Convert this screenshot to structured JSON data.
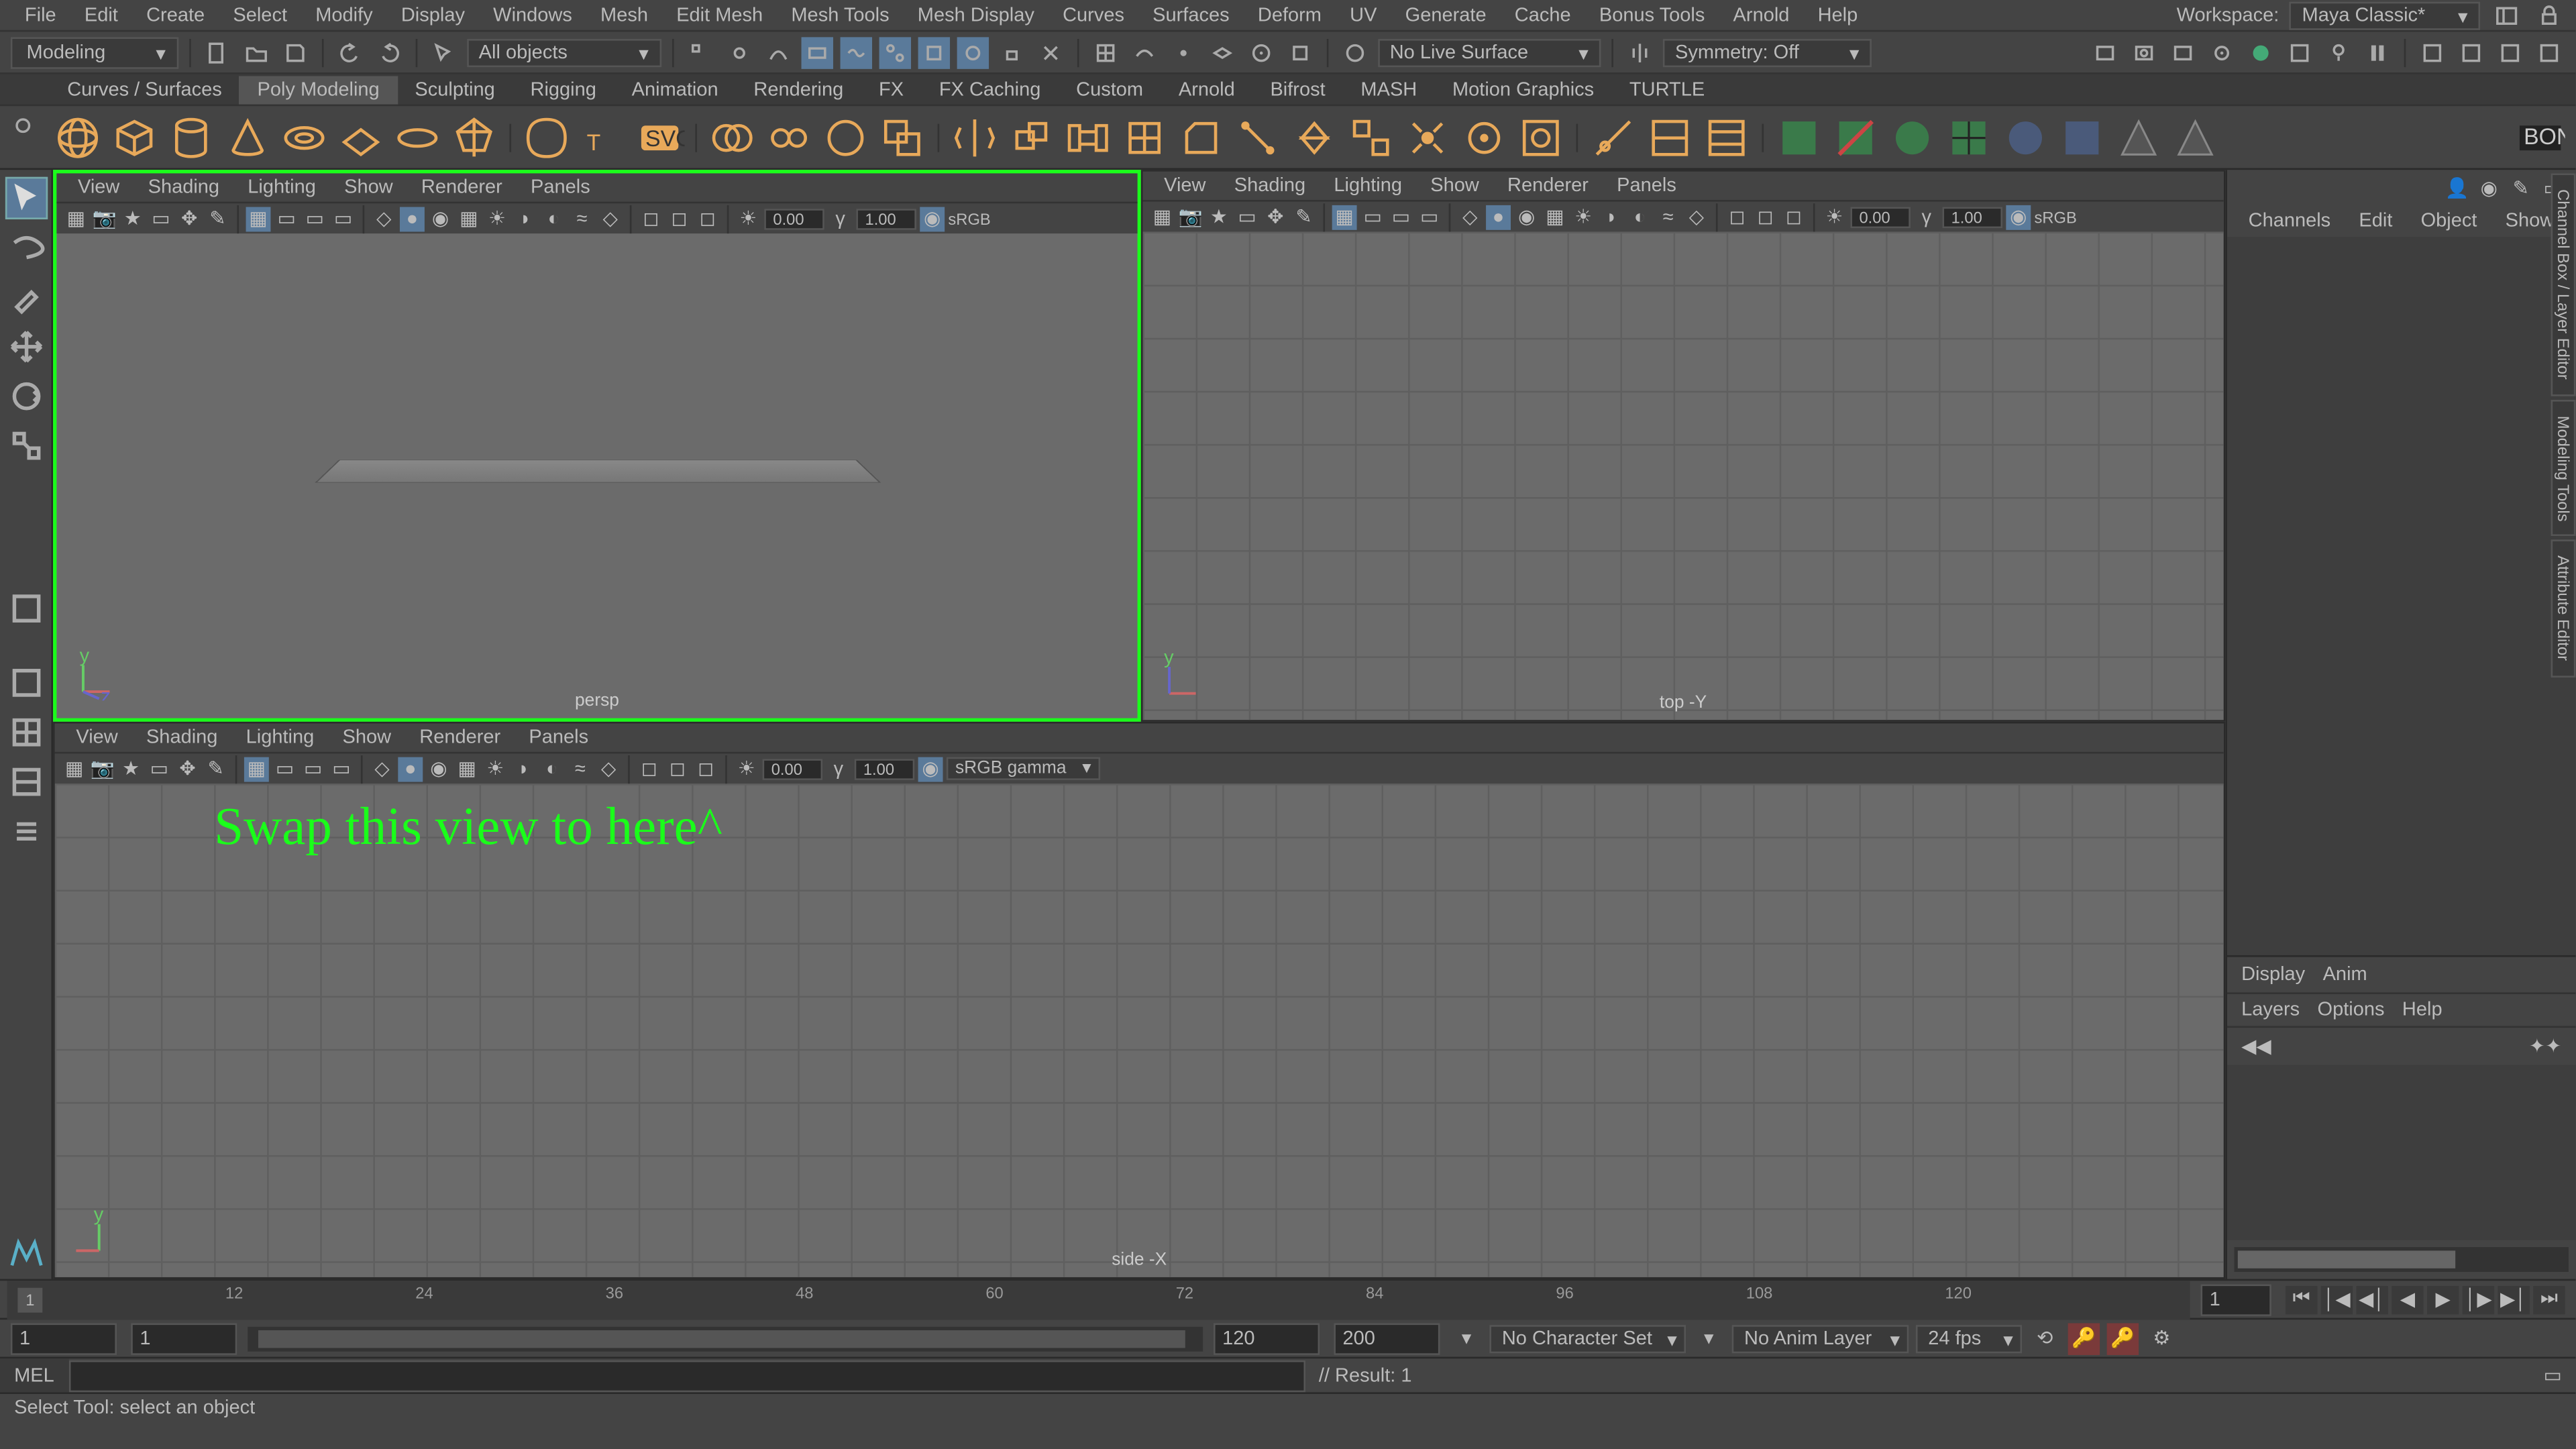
{
  "menubar": {
    "items": [
      "File",
      "Edit",
      "Create",
      "Select",
      "Modify",
      "Display",
      "Windows",
      "Mesh",
      "Edit Mesh",
      "Mesh Tools",
      "Mesh Display",
      "Curves",
      "Surfaces",
      "Deform",
      "UV",
      "Generate",
      "Cache",
      "Bonus Tools",
      "Arnold",
      "Help"
    ],
    "workspace_label": "Workspace:",
    "workspace_value": "Maya Classic*"
  },
  "moderow": {
    "mode": "Modeling",
    "mask_label": "All objects",
    "live_label": "No Live Surface",
    "symmetry_label": "Symmetry: Off"
  },
  "shelftabs": [
    "Curves / Surfaces",
    "Poly Modeling",
    "Sculpting",
    "Rigging",
    "Animation",
    "Rendering",
    "FX",
    "FX Caching",
    "Custom",
    "Arnold",
    "Bifrost",
    "MASH",
    "Motion Graphics",
    "TURTLE"
  ],
  "shelftabs_active": 1,
  "viewport_menu": [
    "View",
    "Shading",
    "Lighting",
    "Show",
    "Renderer",
    "Panels"
  ],
  "vp": {
    "val1": "0.00",
    "val2": "1.00",
    "srgb_short": "sRGB",
    "srgb_full": "sRGB gamma"
  },
  "viewports": {
    "topleft": "persp",
    "topright": "top -Y",
    "bottom": "side -X"
  },
  "annotation": "Swap this view to here^",
  "rightpanel": {
    "tabs": [
      "Channels",
      "Edit",
      "Object",
      "Show"
    ],
    "lower_tabs": [
      "Display",
      "Anim"
    ],
    "lower_tabs2": [
      "Layers",
      "Options",
      "Help"
    ]
  },
  "side_tabs": [
    "Channel Box / Layer Editor",
    "Modeling Tools",
    "Attribute Editor"
  ],
  "timeline": {
    "start": "1",
    "ticks": [
      "12",
      "24",
      "36",
      "48",
      "60",
      "72",
      "84",
      "96",
      "108",
      "120"
    ],
    "current": "1"
  },
  "range": {
    "start": "1",
    "in": "1",
    "out": "120",
    "end": "200",
    "charset": "No Character Set",
    "animlayer": "No Anim Layer",
    "fps": "24 fps"
  },
  "cmdline": {
    "lang": "MEL",
    "result": "// Result: 1"
  },
  "status": "Select Tool: select an object",
  "colors": {
    "highlight": "#1aff1a",
    "shelf": "#e8a95a",
    "bg": "#444444",
    "panel": "#3a3a3a"
  }
}
